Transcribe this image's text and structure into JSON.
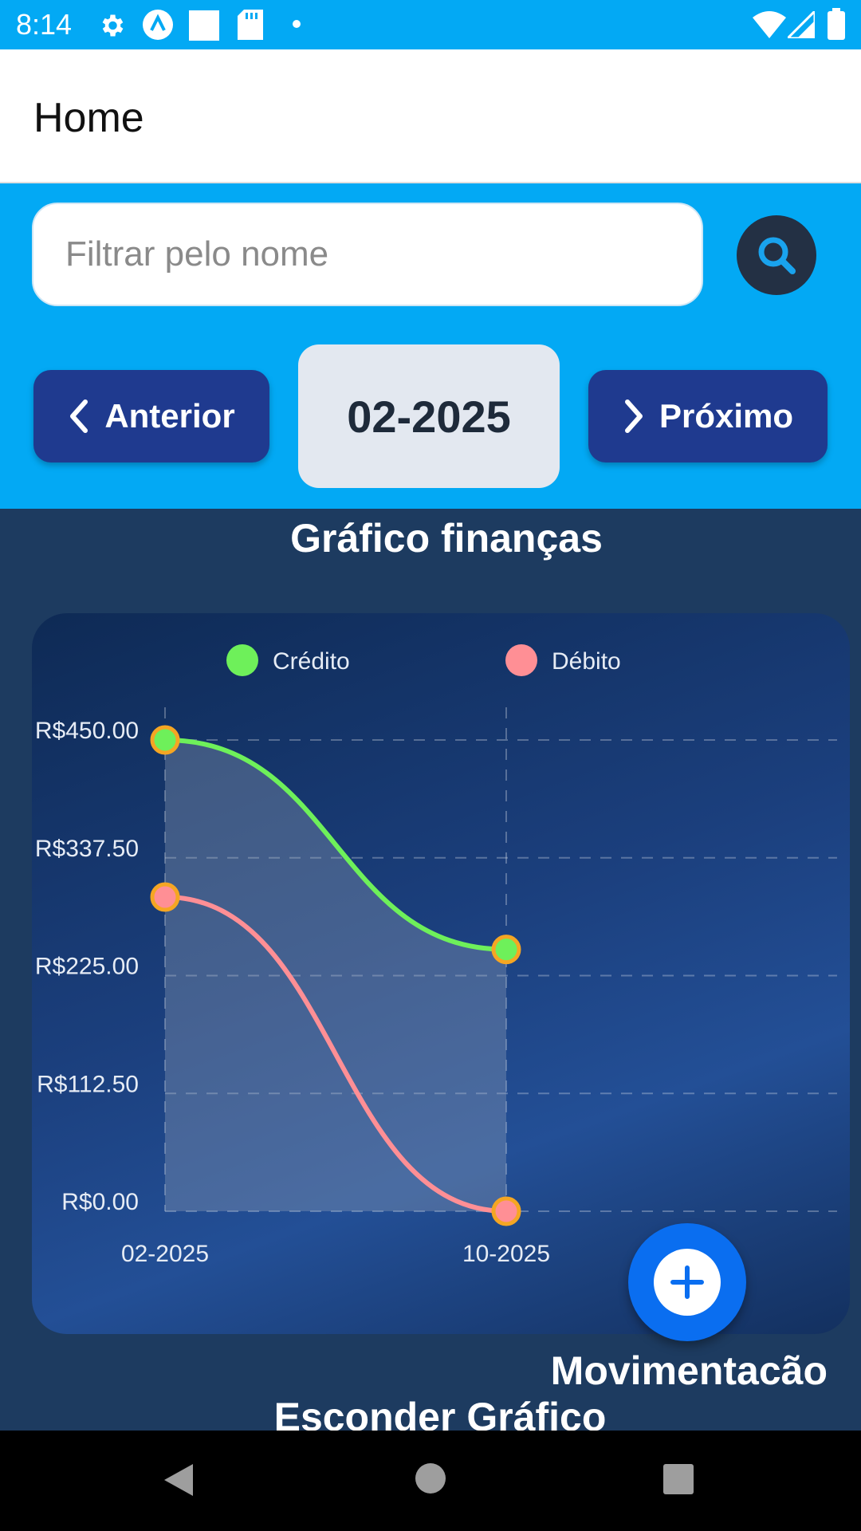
{
  "status_bar": {
    "time": "8:14",
    "icons": [
      "gear-icon",
      "a-logo-icon",
      "square-icon",
      "sd-card-icon",
      "dot-icon",
      "wifi-icon",
      "signal-icon",
      "battery-icon"
    ]
  },
  "app_bar": {
    "title": "Home"
  },
  "filter": {
    "search_placeholder": "Filtrar pelo nome",
    "search_value": "",
    "prev_label": "Anterior",
    "next_label": "Próximo",
    "period": "02-2025"
  },
  "colors": {
    "status_bar": "#03a9f4",
    "nav_button": "#1f3a8f",
    "credit": "#6ef05a",
    "debit": "#ff8f95",
    "marker_border": "#f5a623",
    "fab": "#0a6ef0"
  },
  "chart_data": {
    "type": "line",
    "title": "Gráfico finanças",
    "x": [
      "02-2025",
      "10-2025"
    ],
    "series": [
      {
        "name": "Crédito",
        "values": [
          450,
          250
        ],
        "color": "#6ef05a"
      },
      {
        "name": "Débito",
        "values": [
          300,
          0
        ],
        "color": "#ff8f95"
      }
    ],
    "y_ticks": [
      "R$450.00",
      "R$337.50",
      "R$225.00",
      "R$112.50",
      "R$0.00"
    ],
    "ylim": [
      0,
      450
    ],
    "grid": true,
    "legend": "top",
    "smooth": true
  },
  "fab": {
    "label": "Movimentacão"
  },
  "toggle_chart_label": "Esconder Gráfico"
}
